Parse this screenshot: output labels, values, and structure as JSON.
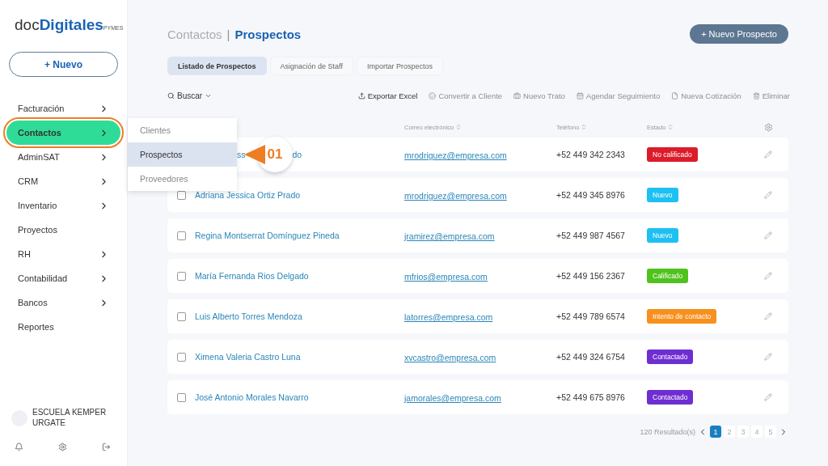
{
  "logo": {
    "prefix": "doc",
    "brand": "Digitales",
    "suffix": "PYMES"
  },
  "new_button": "+ Nuevo",
  "sidebar": {
    "items": [
      {
        "label": "Facturación",
        "has_submenu": true,
        "selected": false
      },
      {
        "label": "Contactos",
        "has_submenu": true,
        "selected": true
      },
      {
        "label": "AdminSAT",
        "has_submenu": true,
        "selected": false
      },
      {
        "label": "CRM",
        "has_submenu": true,
        "selected": false
      },
      {
        "label": "Inventario",
        "has_submenu": true,
        "selected": false
      },
      {
        "label": "Proyectos",
        "has_submenu": false,
        "selected": false
      },
      {
        "label": "RH",
        "has_submenu": true,
        "selected": false
      },
      {
        "label": "Contabilidad",
        "has_submenu": true,
        "selected": false
      },
      {
        "label": "Bancos",
        "has_submenu": true,
        "selected": false
      },
      {
        "label": "Reportes",
        "has_submenu": false,
        "selected": false
      }
    ],
    "account": "ESCUELA KEMPER URGATE"
  },
  "submenu": [
    {
      "label": "Clientes",
      "selected": false
    },
    {
      "label": "Prospectos",
      "selected": true
    },
    {
      "label": "Proveedores",
      "selected": false
    }
  ],
  "callout": "01",
  "breadcrumb": {
    "parent": "Contactos",
    "separator": "|",
    "current": "Prospectos"
  },
  "primary_button": "+ Nuevo Prospecto",
  "tabs": [
    {
      "label": "Listado de Prospectos",
      "selected": true
    },
    {
      "label": "Asignación de Staff",
      "selected": false
    },
    {
      "label": "Importar Prospectos",
      "selected": false
    }
  ],
  "search": "Buscar",
  "actions": [
    {
      "label": "Exportar Excel",
      "kind": "export",
      "disabled": false
    },
    {
      "label": "Convertir a Cliente",
      "kind": "convert",
      "disabled": true
    },
    {
      "label": "Nuevo Trato",
      "kind": "deal",
      "disabled": true
    },
    {
      "label": "Agendar Seguimiento",
      "kind": "schedule",
      "disabled": true
    },
    {
      "label": "Nueva Cotización",
      "kind": "quote",
      "disabled": true
    },
    {
      "label": "Eliminar",
      "kind": "delete",
      "disabled": true
    }
  ],
  "table": {
    "columns": [
      "Correo electrónico",
      "Teléfono",
      "Estado"
    ],
    "rows": [
      {
        "name_fragments": [
          "ss",
          "do"
        ],
        "email": "mrodriguez@empresa.com",
        "phone": "+52 449 342 2343",
        "status": "No calificado",
        "color": "#dc1c2a"
      },
      {
        "name": "Adriana Jessica Ortiz Prado",
        "email": "mrodriguez@empresa.com",
        "phone": "+52 449 345 8976",
        "status": "Nuevo",
        "color": "#1ec0f2",
        "checked": false
      },
      {
        "name": "Regina Montserrat Domínguez Pineda",
        "email": "jramirez@empresa.com",
        "phone": "+52 449 987 4567",
        "status": "Nuevo",
        "color": "#1ec0f2",
        "checked": false
      },
      {
        "name": "María Fernanda Rios Delgado",
        "email": "mfrios@empresa.com",
        "phone": "+52 449 156 2367",
        "status": "Calificado",
        "color": "#4fc21c",
        "checked": false
      },
      {
        "name": "Luis Alberto Torres Mendoza",
        "email": "latorres@empresa.com",
        "phone": "+52 449 789 6574",
        "status": "Intento de contacto",
        "color": "#f7901e",
        "checked": false
      },
      {
        "name": "Ximena Valeria Castro Luna",
        "email": "xvcastro@empresa.com",
        "phone": "+52 449 324 6754",
        "status": "Contactado",
        "color": "#6f2ed1",
        "checked": false
      },
      {
        "name": "José Antonio Morales Navarro",
        "email": "jamorales@empresa.com",
        "phone": "+52 449 675 8976",
        "status": "Contactado",
        "color": "#6f2ed1",
        "checked": false
      }
    ]
  },
  "pagination": {
    "results": "120 Resultado(s)",
    "pages": [
      {
        "label": "1",
        "selected": true
      },
      {
        "label": "2",
        "selected": false
      },
      {
        "label": "3",
        "selected": false
      },
      {
        "label": "4",
        "selected": false
      },
      {
        "label": "5",
        "selected": false
      }
    ]
  }
}
